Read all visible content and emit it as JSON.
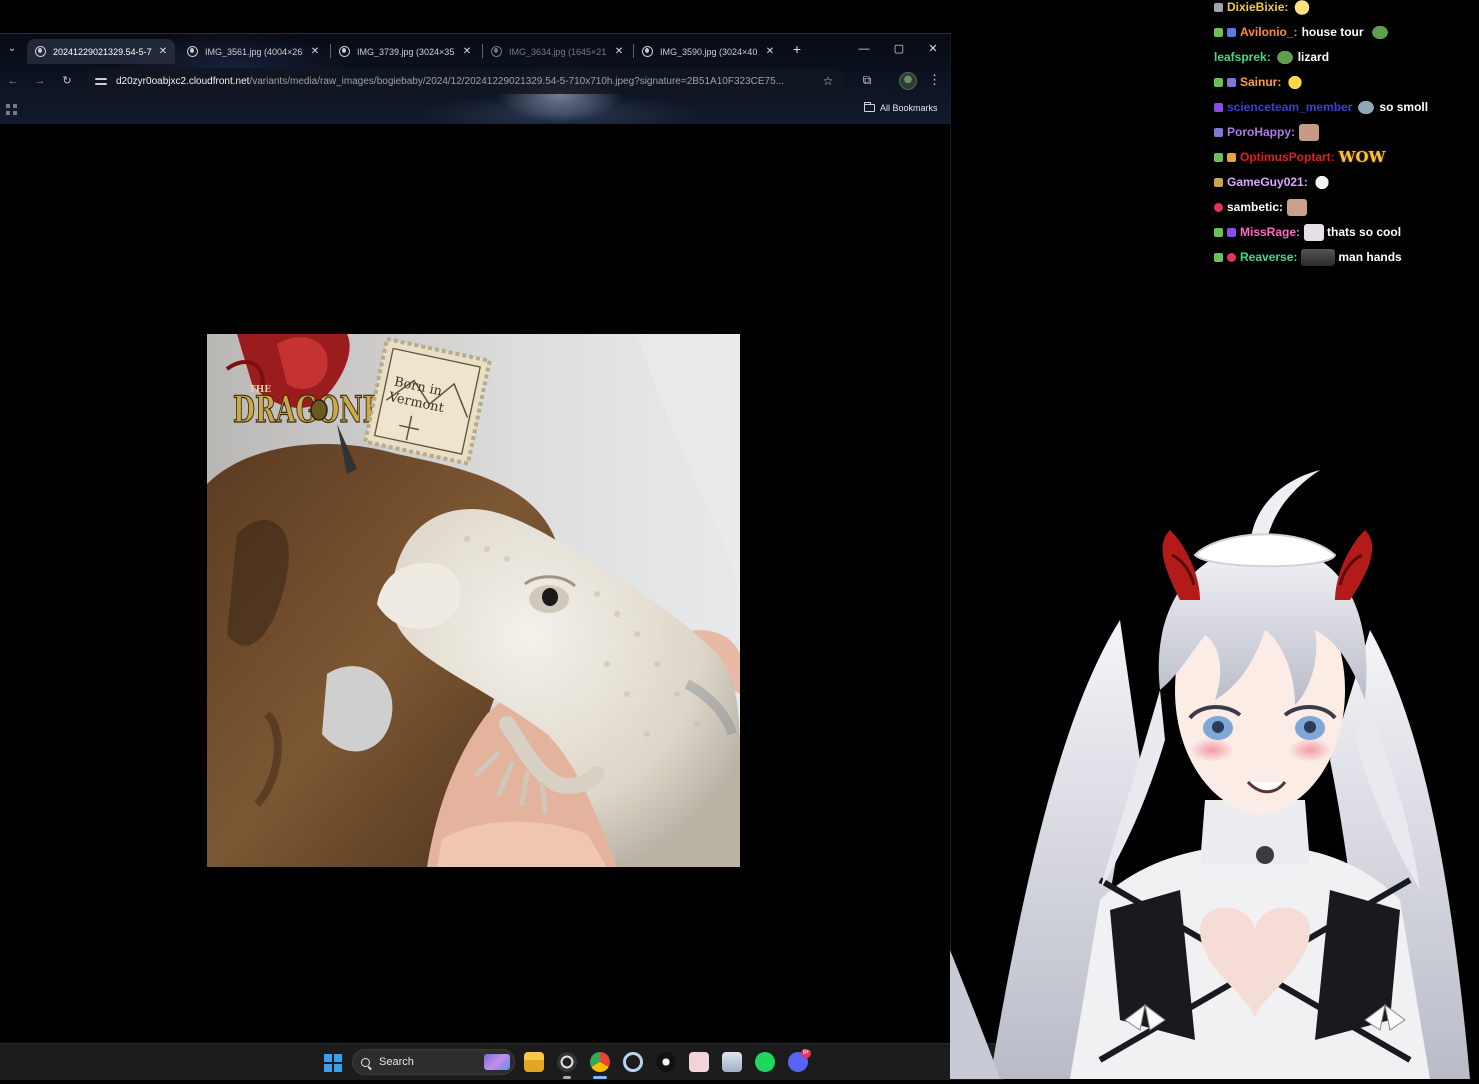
{
  "browser": {
    "tabs": [
      {
        "title": "20241229021329.54-5-7",
        "active": true
      },
      {
        "title": "IMG_3561.jpg (4004×26",
        "active": false
      },
      {
        "title": "IMG_3739.jpg (3024×35",
        "active": false
      },
      {
        "title": "IMG_3634.jpg (1645×21",
        "active": false,
        "dim": true
      },
      {
        "title": "IMG_3590.jpg (3024×40",
        "active": false
      }
    ],
    "tab_close_glyph": "✕",
    "new_tab_glyph": "+",
    "window_buttons": {
      "minimize": "—",
      "maximize": "▢",
      "close": "✕"
    },
    "nav": {
      "back": "←",
      "forward": "→",
      "reload": "↻"
    },
    "url": {
      "host": "d20zyr0oabjxc2.cloudfront.net",
      "path": "/variants/media/raw_images/bogiebaby/2024/12/20241229021329.54-5-710x710h.jpeg?signature=2B51A10F323CE75..."
    },
    "bookmark_star": "☆",
    "bookmarks_label": "All Bookmarks"
  },
  "image": {
    "logo_text": "DRAGONRY",
    "logo_small_text": "THE",
    "stamp_text_1": "Born in",
    "stamp_text_2": "Vermont",
    "colors": {
      "background": "#dcdcdc",
      "driftwood": "#6b4a2c",
      "lizard": "#e9e4da",
      "skin": "#e8b9a4"
    }
  },
  "taskbar": {
    "search_label": "Search",
    "apps": [
      "file-explorer",
      "obs",
      "chrome",
      "ccleaner",
      "streamer-app",
      "gallery-app",
      "notes-app",
      "spotify",
      "discord"
    ],
    "discord_badge": "9+"
  },
  "chat": {
    "messages": [
      {
        "user": "DixieBixie:",
        "color": "#f2c94c",
        "text": "",
        "emote": true
      },
      {
        "user": "Avilonio_:",
        "color": "#ff8c3a",
        "text": "house tour",
        "emote_after": true
      },
      {
        "user": "leafsprek:",
        "color": "#3ddc84",
        "text": "lizard",
        "emote": true
      },
      {
        "user": "Sainur:",
        "color": "#ff9f43",
        "text": "",
        "emote": true
      },
      {
        "user": "scienceteam_member",
        "color": "#3e3ecf",
        "text": "so smoll",
        "emote": true
      },
      {
        "user": "PoroHappy:",
        "color": "#b07be6",
        "text": "",
        "emote": true
      },
      {
        "user": "OptimusPoptart:",
        "color": "#e02020",
        "text": "",
        "emote": true
      },
      {
        "user": "GameGuy021:",
        "color": "#d8a8ff",
        "text": "",
        "emote": true
      },
      {
        "user": "sambetic:",
        "color": "#ffffff",
        "text": "",
        "emote": true
      },
      {
        "user": "MissRage:",
        "color": "#ff69c8",
        "text": "thats so cool",
        "emote": true
      },
      {
        "user": "Reaverse:",
        "color": "#3ddc84",
        "text": "man hands",
        "emote": true
      }
    ],
    "wow_emote": "WOW"
  }
}
